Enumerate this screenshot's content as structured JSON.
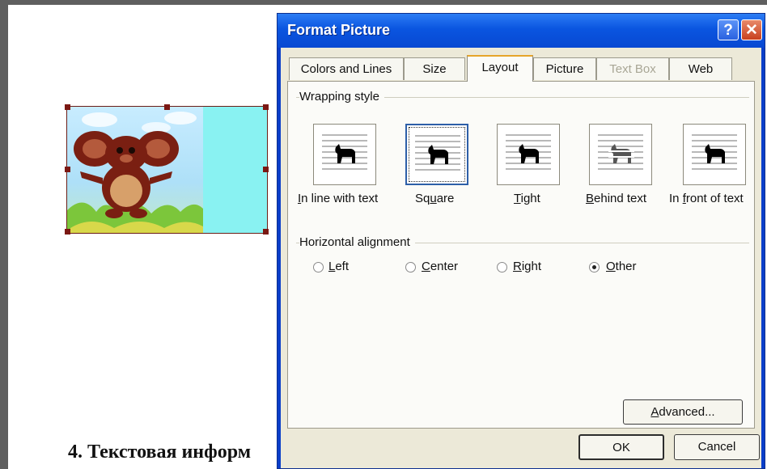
{
  "document": {
    "heading_text": "4. Текстовая информ"
  },
  "dialog": {
    "title": "Format Picture",
    "help_glyph": "?",
    "close_glyph": "✕",
    "tabs": [
      {
        "label": "Colors and Lines",
        "state": "normal"
      },
      {
        "label": "Size",
        "state": "normal"
      },
      {
        "label": "Layout",
        "state": "active"
      },
      {
        "label": "Picture",
        "state": "normal"
      },
      {
        "label": "Text Box",
        "state": "disabled"
      },
      {
        "label": "Web",
        "state": "normal"
      }
    ],
    "wrapping": {
      "group_label": "Wrapping style",
      "options": [
        {
          "label_pre": "",
          "label_key": "I",
          "label_post": "n line with text",
          "icon": "inline-wrap-icon"
        },
        {
          "label_pre": "Sq",
          "label_key": "u",
          "label_post": "are",
          "icon": "square-wrap-icon",
          "selected": true
        },
        {
          "label_pre": "",
          "label_key": "T",
          "label_post": "ight",
          "icon": "tight-wrap-icon"
        },
        {
          "label_pre": "",
          "label_key": "B",
          "label_post": "ehind text",
          "icon": "behind-text-wrap-icon"
        },
        {
          "label_pre": "In ",
          "label_key": "f",
          "label_post": "ront of text",
          "icon": "in-front-wrap-icon"
        }
      ]
    },
    "alignment": {
      "group_label": "Horizontal alignment",
      "options": [
        {
          "key": "L",
          "rest": "eft",
          "checked": false
        },
        {
          "key": "C",
          "rest": "enter",
          "checked": false
        },
        {
          "key": "R",
          "rest": "ight",
          "checked": false
        },
        {
          "key": "O",
          "rest": "ther",
          "checked": true
        }
      ]
    },
    "advanced_button": {
      "pre": "",
      "key": "A",
      "post": "dvanced..."
    },
    "ok_label": "OK",
    "cancel_label": "Cancel"
  },
  "colors": {
    "title_bar": "#0a55e0",
    "dialog_face": "#ece9d8",
    "selection_border": "#2d5fa8"
  }
}
